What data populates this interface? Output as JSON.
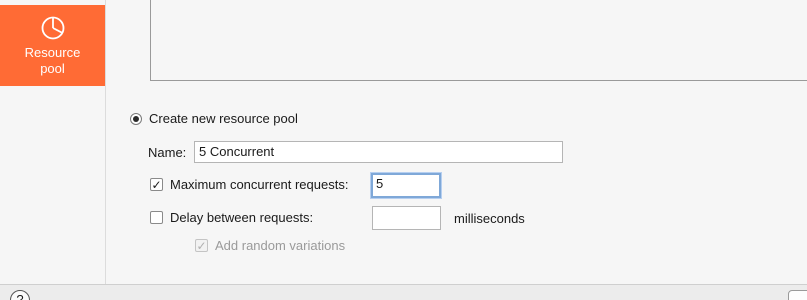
{
  "sidebar": {
    "items": [
      {
        "label": "Resource pool",
        "icon": "pie-chart-icon",
        "active": true,
        "color": "#ff6b35"
      }
    ]
  },
  "resource_pool": {
    "create_new_label": "Create new resource pool",
    "create_new_selected": true,
    "name_label": "Name:",
    "name_value": "5 Concurrent",
    "max_concurrent": {
      "label": "Maximum concurrent requests:",
      "checked": true,
      "value": "5"
    },
    "delay": {
      "label": "Delay between requests:",
      "checked": false,
      "value": "",
      "unit": "milliseconds"
    },
    "random_variations": {
      "label": "Add random variations",
      "checked": true,
      "enabled": false
    }
  },
  "footer": {
    "help_symbol": "?"
  }
}
